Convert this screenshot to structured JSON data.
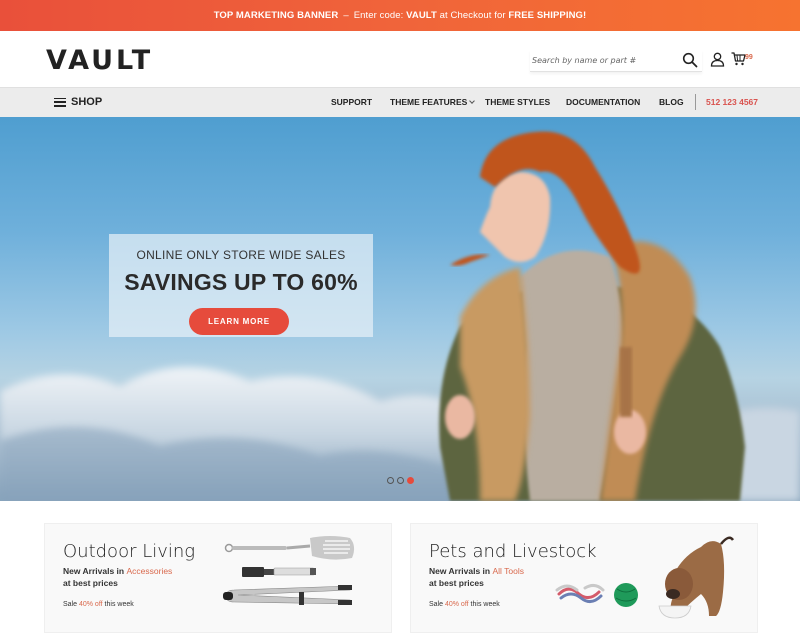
{
  "banner": {
    "lead": "TOP MARKETING BANNER",
    "separator": "–",
    "text_before_code": "Enter code:",
    "code": "VAULT",
    "text_after_code": "at Checkout for",
    "highlight": "FREE SHIPPING!"
  },
  "header": {
    "logo": "VAULT",
    "search_placeholder": "Search by name or part #",
    "search_icon": "search-icon",
    "account_icon": "user-icon",
    "cart_icon": "cart-icon",
    "cart_count": "99"
  },
  "nav": {
    "shop_label": "SHOP",
    "items": [
      {
        "label": "SUPPORT"
      },
      {
        "label": "THEME FEATURES",
        "has_dropdown": true
      },
      {
        "label": "THEME STYLES"
      },
      {
        "label": "DOCUMENTATION"
      },
      {
        "label": "BLOG"
      }
    ],
    "phone": "512 123 4567"
  },
  "hero": {
    "subtitle": "ONLINE ONLY STORE WIDE SALES",
    "title": "SAVINGS UP TO 60%",
    "button_label": "LEARN MORE",
    "slides_total": 3,
    "active_slide": 3
  },
  "cards": [
    {
      "title": "Outdoor Living",
      "line1_prefix": "New Arrivals in",
      "line1_accent": "Accessories",
      "line2": "at best prices",
      "sale_prefix": "Sale",
      "sale_accent": "40% off",
      "sale_suffix": "this week"
    },
    {
      "title": "Pets and Livestock",
      "line1_prefix": "New Arrivals in",
      "line1_accent": "All Tools",
      "line2": "at best prices",
      "sale_prefix": "Sale",
      "sale_accent": "40% off",
      "sale_suffix": "this week"
    }
  ],
  "colors": {
    "accent": "#e64b3c",
    "banner_start": "#e9503a",
    "banner_end": "#f67330",
    "price_accent": "#d9694d"
  }
}
